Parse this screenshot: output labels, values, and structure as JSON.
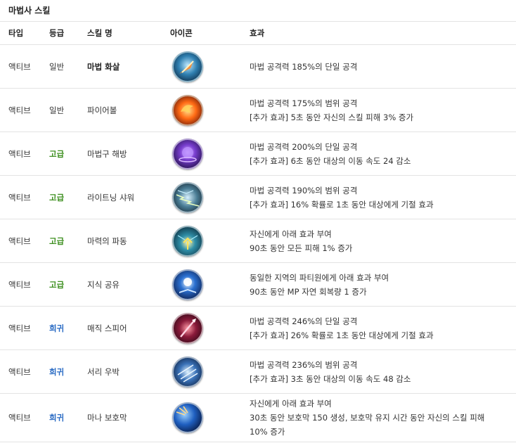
{
  "title": "마법사 스킬",
  "headers": {
    "type": "타입",
    "grade": "등급",
    "name": "스킬 명",
    "icon": "아이콘",
    "effect": "효과"
  },
  "rows": [
    {
      "type": "액티브",
      "grade": "일반",
      "grade_level": "normal",
      "name": "마법 화살",
      "icon": "magic-arrow-icon",
      "effect": [
        "마법 공격력 185%의 단일 공격"
      ]
    },
    {
      "type": "액티브",
      "grade": "일반",
      "grade_level": "normal",
      "name": "파이어볼",
      "icon": "fireball-icon",
      "effect": [
        "마법 공격력 175%의 범위 공격",
        "[추가 효과] 5초 동안 자신의 스킬 피해 3% 증가"
      ]
    },
    {
      "type": "액티브",
      "grade": "고급",
      "grade_level": "advanced",
      "name": "마법구 해방",
      "icon": "magic-orb-icon",
      "effect": [
        "마법 공격력 200%의 단일 공격",
        "[추가 효과] 6초 동안 대상의 이동 속도 24 감소"
      ]
    },
    {
      "type": "액티브",
      "grade": "고급",
      "grade_level": "advanced",
      "name": "라이트닝 샤워",
      "icon": "lightning-icon",
      "effect": [
        "마법 공격력 190%의 범위 공격",
        "[추가 효과] 16% 확률로 1초 동안 대상에게 기절 효과"
      ]
    },
    {
      "type": "액티브",
      "grade": "고급",
      "grade_level": "advanced",
      "name": "마력의 파동",
      "icon": "mana-wave-icon",
      "effect": [
        "자신에게 아래 효과 부여",
        "90초 동안 모든 피해 1% 증가"
      ]
    },
    {
      "type": "액티브",
      "grade": "고급",
      "grade_level": "advanced",
      "name": "지식 공유",
      "icon": "knowledge-icon",
      "effect": [
        "동일한 지역의 파티원에게 아래 효과 부여",
        "90초 동안 MP 자연 회복량 1 증가"
      ]
    },
    {
      "type": "액티브",
      "grade": "희귀",
      "grade_level": "rare",
      "name": "매직 스피어",
      "icon": "magic-spear-icon",
      "effect": [
        "마법 공격력 246%의 단일 공격",
        "[추가 효과] 26% 확률로 1초 동안 대상에게 기절 효과"
      ]
    },
    {
      "type": "액티브",
      "grade": "희귀",
      "grade_level": "rare",
      "name": "서리 우박",
      "icon": "frost-hail-icon",
      "effect": [
        "마법 공격력 236%의 범위 공격",
        "[추가 효과] 3초 동안 대상의 이동 속도 48 감소"
      ]
    },
    {
      "type": "액티브",
      "grade": "희귀",
      "grade_level": "rare",
      "name": "마나 보호막",
      "icon": "mana-shield-icon",
      "effect": [
        "자신에게 아래 효과 부여",
        "30초 동안 보호막 150 생성, 보호막 유지 시간 동안 자신의 스킬 피해",
        "10% 증가"
      ]
    }
  ]
}
